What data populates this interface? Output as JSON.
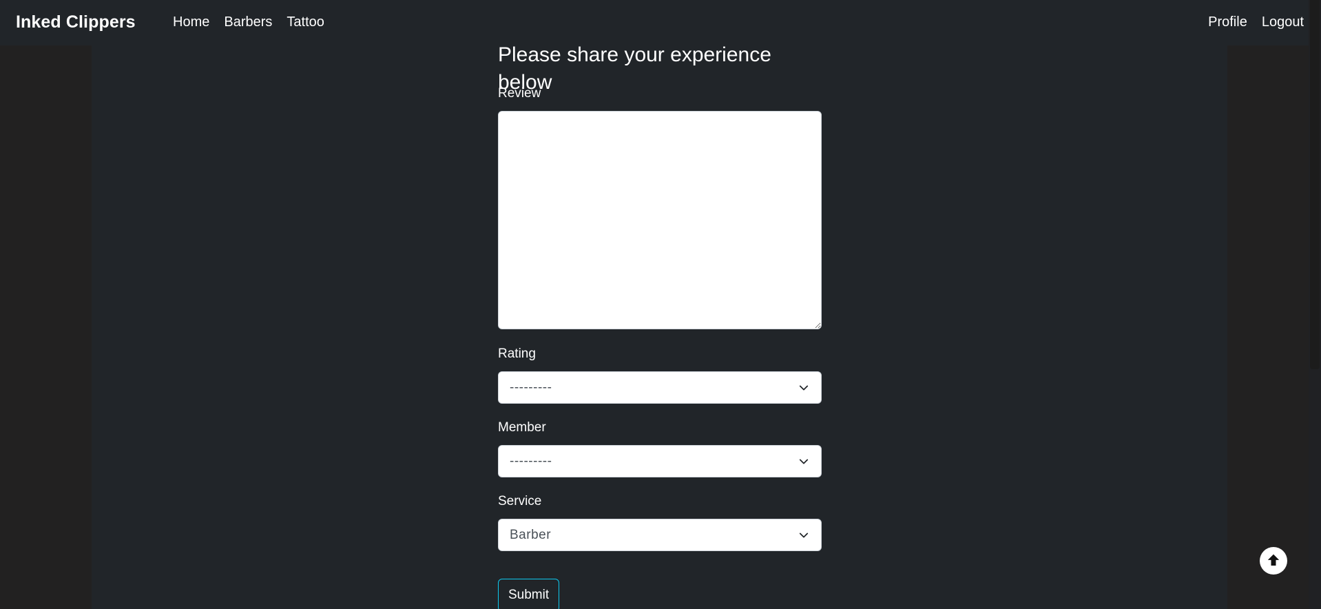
{
  "navbar": {
    "brand": "Inked Clippers",
    "left_links": [
      "Home",
      "Barbers",
      "Tattoo"
    ],
    "right_links": [
      "Profile",
      "Logout"
    ]
  },
  "form": {
    "title": "Please share your experience below",
    "review_label": "Review",
    "review_value": "",
    "rating_label": "Rating",
    "rating_value": "---------",
    "member_label": "Member",
    "member_value": "---------",
    "service_label": "Service",
    "service_value": "Barber",
    "submit_label": "Submit"
  },
  "icons": {
    "select_chevron": "chevron-down-icon",
    "back_to_top": "arrow-up-circle-icon",
    "resize": "resize-grip-icon"
  },
  "colors": {
    "background": "#212529",
    "gutter": "#222121",
    "submit_border": "#0dcaf0",
    "text": "#ffffff"
  }
}
